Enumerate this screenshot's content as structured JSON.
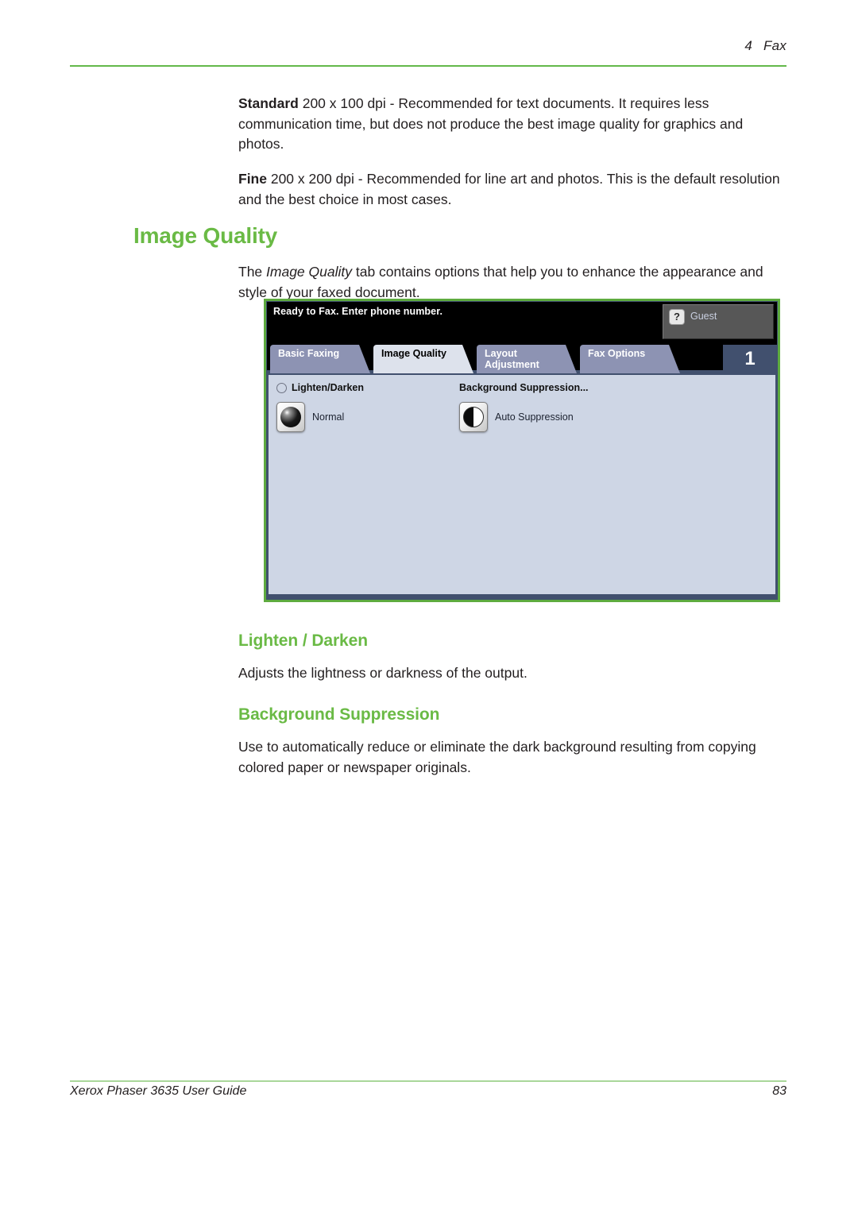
{
  "header": {
    "chapter_number": "4",
    "chapter_title": "Fax"
  },
  "body": {
    "para_standard_bold": "Standard",
    "para_standard_rest": " 200 x 100 dpi - Recommended for text documents. It requires less communication time, but does not produce the best image quality for graphics and photos.",
    "para_fine_bold": "Fine",
    "para_fine_rest": " 200 x 200 dpi - Recommended for line art and photos. This is the default resolution and the best choice in most cases."
  },
  "section_image_quality": {
    "heading": "Image Quality",
    "intro_before": "The ",
    "intro_italic": "Image Quality",
    "intro_after": " tab contains options that help you to enhance the appearance and style of your faxed document."
  },
  "device_screen": {
    "status_message": "Ready to Fax. Enter phone number.",
    "user_button": {
      "icon": "question-mark-icon",
      "glyph": "?",
      "label": "Guest"
    },
    "page_indicator": "1",
    "tabs": [
      {
        "label_line1": "Basic Faxing",
        "label_line2": "",
        "active": false
      },
      {
        "label_line1": "Image Quality",
        "label_line2": "",
        "active": true
      },
      {
        "label_line1": "Layout",
        "label_line2": "Adjustment",
        "active": false
      },
      {
        "label_line1": "Fax Options",
        "label_line2": "",
        "active": false
      }
    ],
    "options": [
      {
        "group_label": "Lighten/Darken",
        "has_radio": true,
        "icon": "gradient-sphere-icon",
        "value_label": "Normal"
      },
      {
        "group_label": "Background Suppression...",
        "has_radio": false,
        "icon": "half-black-half-white-circle-icon",
        "value_label": "Auto Suppression"
      }
    ]
  },
  "section_lighten_darken": {
    "heading": "Lighten / Darken",
    "text": "Adjusts the lightness or darkness of the output."
  },
  "section_background_suppression": {
    "heading": "Background Suppression",
    "text": "Use to automatically reduce or eliminate the dark background resulting from copying colored paper or newspaper originals."
  },
  "footer": {
    "guide_title": "Xerox Phaser 3635 User Guide",
    "page_number": "83"
  },
  "colors": {
    "accent_green": "#6aba45",
    "rule_green": "#63b84a",
    "footer_rule_green": "#a9d79a",
    "panel_blue": "#ced6e5",
    "tab_inactive": "#8d93b3",
    "tab_active": "#dde2ec",
    "dark_slate": "#41506e"
  }
}
